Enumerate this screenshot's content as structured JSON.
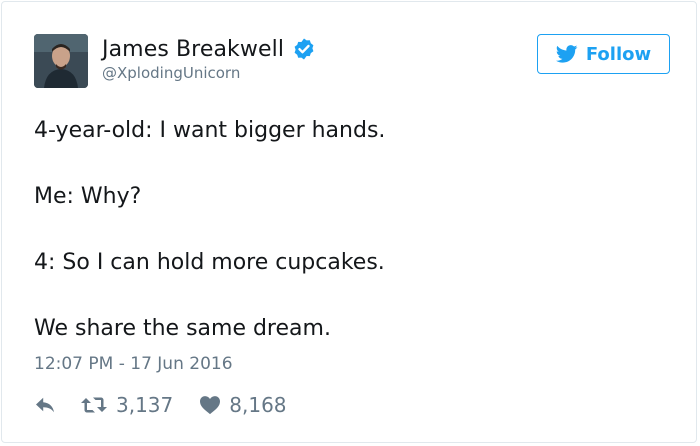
{
  "user": {
    "display_name": "James Breakwell",
    "handle": "@XplodingUnicorn",
    "verified_icon": "verified-badge-icon"
  },
  "follow_button": {
    "label": "Follow",
    "icon": "twitter-bird-icon"
  },
  "tweet": {
    "lines": [
      "4-year-old: I want bigger hands.",
      "Me: Why?",
      "4: So I can hold more cupcakes.",
      "We share the same dream."
    ],
    "timestamp": "12:07 PM - 17 Jun 2016"
  },
  "actions": {
    "reply_icon": "reply-icon",
    "retweet_icon": "retweet-icon",
    "retweet_count": "3,137",
    "like_icon": "heart-icon",
    "like_count": "8,168"
  },
  "colors": {
    "brand_blue": "#1da1f2",
    "text_primary": "#14171a",
    "text_secondary": "#657786",
    "border": "#e1e8ed"
  }
}
